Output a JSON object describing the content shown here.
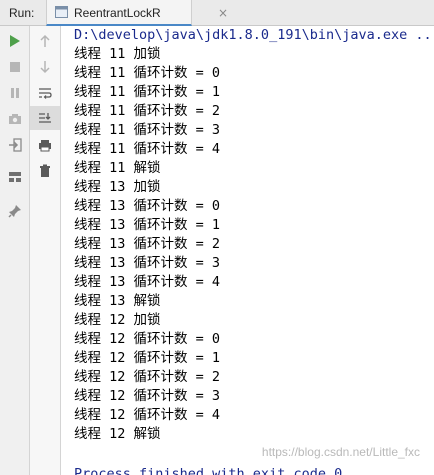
{
  "header": {
    "run_label": "Run:",
    "tab_title": "ReentrantLockR",
    "tab_close": "×"
  },
  "toolbar_left": [
    {
      "name": "run-icon"
    },
    {
      "name": "stop-icon"
    },
    {
      "name": "pause-icon"
    },
    {
      "name": "camera-icon"
    },
    {
      "name": "login-icon"
    },
    {
      "name": "layout-icon"
    },
    {
      "name": "pin-icon"
    }
  ],
  "toolbar_right": [
    {
      "name": "up-arrow-icon"
    },
    {
      "name": "down-arrow-icon"
    },
    {
      "name": "soft-wrap-icon"
    },
    {
      "name": "scroll-to-end-icon"
    },
    {
      "name": "print-icon"
    },
    {
      "name": "trash-icon"
    }
  ],
  "console": {
    "command": "D:\\develop\\java\\jdk1.8.0_191\\bin\\java.exe ...",
    "lines": [
      "线程 11 加锁",
      "线程 11 循环计数 = 0",
      "线程 11 循环计数 = 1",
      "线程 11 循环计数 = 2",
      "线程 11 循环计数 = 3",
      "线程 11 循环计数 = 4",
      "线程 11 解锁",
      "线程 13 加锁",
      "线程 13 循环计数 = 0",
      "线程 13 循环计数 = 1",
      "线程 13 循环计数 = 2",
      "线程 13 循环计数 = 3",
      "线程 13 循环计数 = 4",
      "线程 13 解锁",
      "线程 12 加锁",
      "线程 12 循环计数 = 0",
      "线程 12 循环计数 = 1",
      "线程 12 循环计数 = 2",
      "线程 12 循环计数 = 3",
      "线程 12 循环计数 = 4",
      "线程 12 解锁"
    ],
    "exit_message": "Process finished with exit code 0"
  },
  "watermark": "https://blog.csdn.net/Little_fxc",
  "colors": {
    "run_green": "#4ea04b",
    "command_blue": "#1a2a8c",
    "tab_accent": "#4a88c7"
  }
}
